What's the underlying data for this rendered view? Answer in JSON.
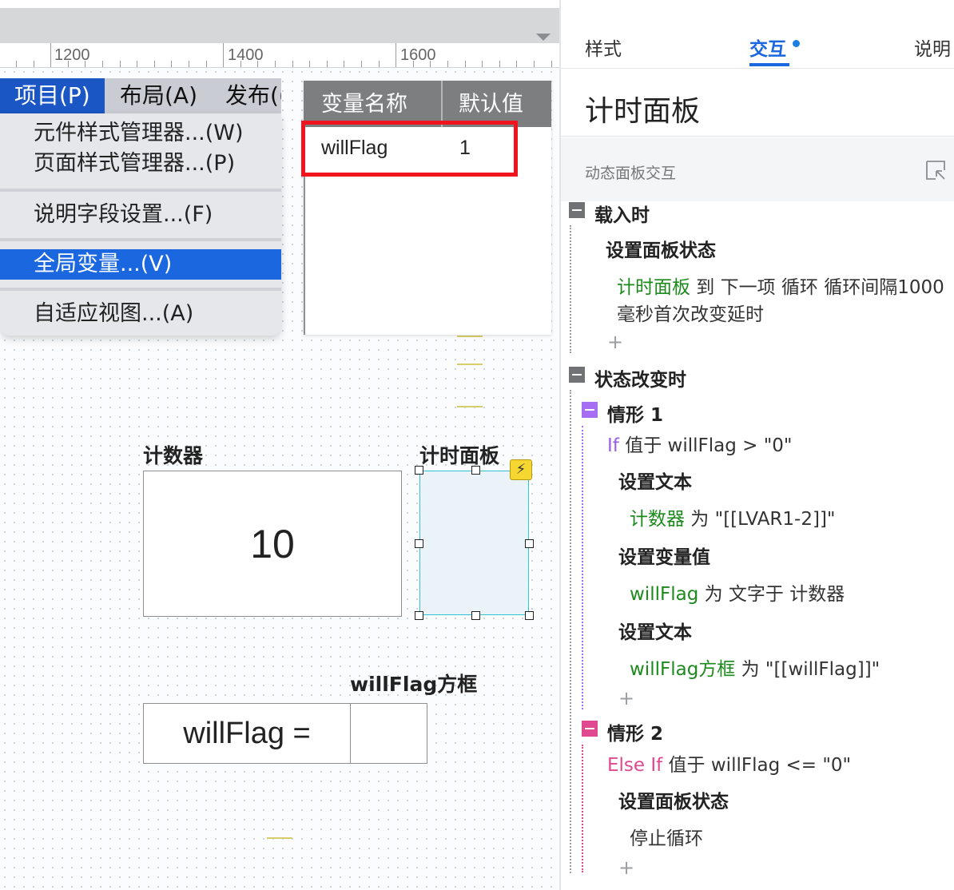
{
  "ruler": {
    "labels": [
      "1200",
      "1400",
      "1600"
    ]
  },
  "menubar": {
    "items": [
      "项目(P)",
      "布局(A)",
      "发布(("
    ]
  },
  "menu": {
    "items": [
      "元件样式管理器...(W)",
      "页面样式管理器...(P)",
      "说明字段设置...(F)",
      "全局变量...(V)",
      "自适应视图...(A)"
    ],
    "highlighted": "全局变量...(V)"
  },
  "variables": {
    "col_name": "变量名称",
    "col_default": "默认值",
    "rows": [
      {
        "name": "willFlag",
        "value": "1"
      }
    ]
  },
  "widgets": {
    "counter_label": "计数器",
    "counter_value": "10",
    "timer_label": "计时面板",
    "willflag_label": "willFlag方框",
    "willflag_text": "willFlag ="
  },
  "inspector": {
    "tabs": [
      "样式",
      "交互",
      "说明"
    ],
    "active_tab": "交互",
    "title": "计时面板",
    "section": "动态面板交互",
    "on_load": {
      "event": "载入时",
      "action": "设置面板状态",
      "target": "计时面板",
      "line1_rest": " 到 下一项 循环 循环间隔1000",
      "line2": "毫秒首次改变延时"
    },
    "on_state_change": {
      "event": "状态改变时",
      "case1": {
        "title": "情形 1",
        "kw": "If",
        "cond": " 值于 willFlag > \"0\"",
        "a1": "设置文本",
        "a1_target": "计数器",
        "a1_rest": " 为 \"[[LVAR1-2]]\"",
        "a2": "设置变量值",
        "a2_target": "willFlag",
        "a2_rest": " 为 文字于 计数器",
        "a3": "设置文本",
        "a3_target": "willFlag方框",
        "a3_rest": " 为 \"[[willFlag]]\""
      },
      "case2": {
        "title": "情形 2",
        "kw": "Else If",
        "cond": " 值于 willFlag <= \"0\"",
        "a1": "设置面板状态",
        "a1_value": "停止循环"
      }
    }
  },
  "colors": {
    "menu_highlight": "#1a67e0",
    "selection_box": "#f0141e",
    "target_green": "#1c8a1c",
    "case1_purple": "#a66ef2",
    "case2_pink": "#e0488f",
    "active_tab_blue": "#1a67e0"
  },
  "icons": [
    "lightning-icon",
    "expand-icon",
    "collapse-icon",
    "add-icon",
    "dropdown-triangle-icon"
  ]
}
